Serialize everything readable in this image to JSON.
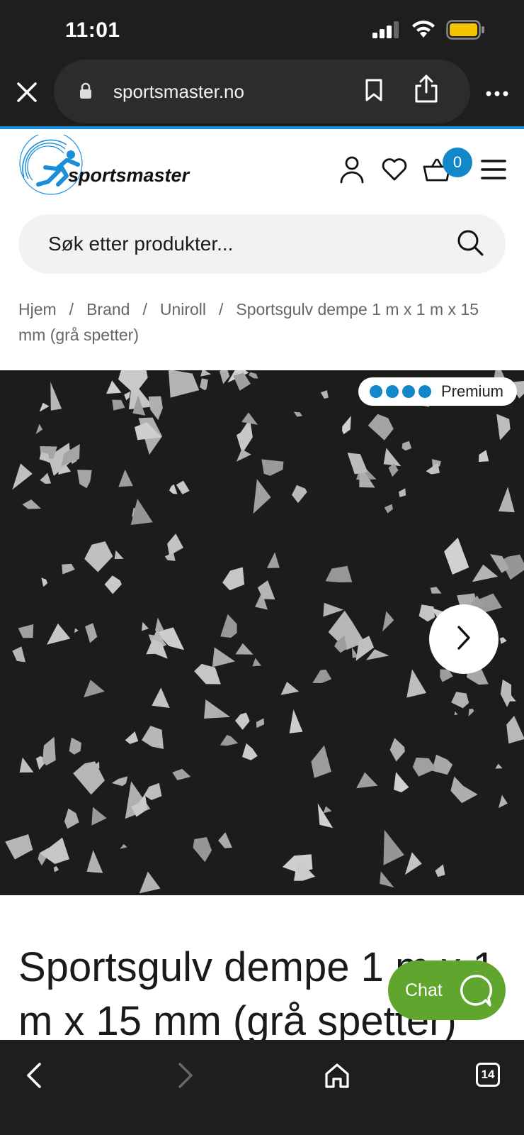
{
  "status_bar": {
    "time": "11:01",
    "battery_color": "#f5c400"
  },
  "browser": {
    "close_icon": "close-icon",
    "lock_icon": "lock-icon",
    "url": "sportsmaster.no",
    "bookmark_icon": "bookmark-icon",
    "share_icon": "share-icon",
    "more_icon": "more-icon",
    "accent_color": "#1a8fd9"
  },
  "header": {
    "logo_text": "sportsmaster",
    "cart_count": "0",
    "badge_color": "#1287c9"
  },
  "search": {
    "placeholder": "Søk etter produkter..."
  },
  "breadcrumb": {
    "items": [
      "Hjem",
      "Brand",
      "Uniroll",
      "Sportsgulv dempe 1 m x 1 m x 15 mm (grå spetter)"
    ],
    "separator": "/"
  },
  "product": {
    "badge_label": "Premium",
    "badge_level": 4,
    "title": "Sportsgulv dempe 1 m x 1 m x 15 mm (grå spetter)"
  },
  "chat": {
    "label": "Chat",
    "color": "#5fa52e"
  },
  "toolbar": {
    "tab_count": "14"
  }
}
